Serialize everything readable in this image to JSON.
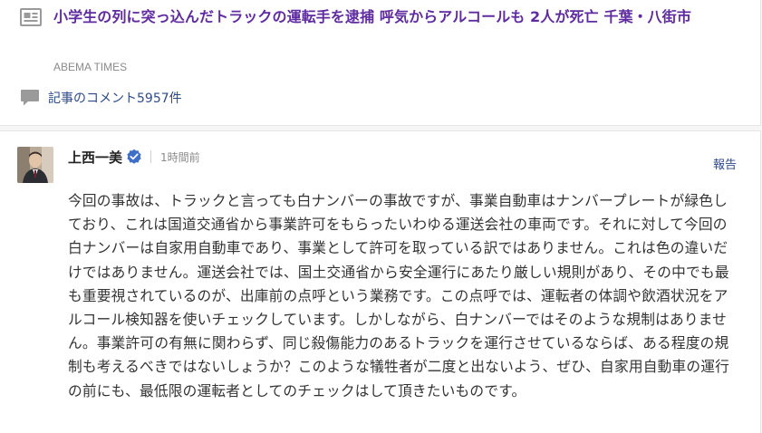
{
  "article": {
    "title": "小学生の列に突っ込んだトラックの運転手を逮捕 呼気からアルコールも 2人が死亡 千葉・八街市",
    "source": "ABEMA TIMES",
    "comments_link": "記事のコメント5957件",
    "icons": {
      "article": "news-article-icon",
      "comments": "speech-bubble-icon"
    }
  },
  "comment": {
    "author": "上西一美",
    "time": "1時間前",
    "report_label": "報告",
    "body": "今回の事故は、トラックと言っても白ナンバーの事故ですが、事業自動車はナンバープレートが緑色しており、これは国道交通省から事業許可をもらったいわゆる運送会社の車両です。それに対して今回の白ナンバーは自家用自動車であり、事業として許可を取っている訳ではありません。これは色の違いだけではありません。運送会社では、国土交通省から安全運行にあたり厳しい規則があり、その中でも最も重要視されているのが、出庫前の点呼という業務です。この点呼では、運転者の体調や飲酒状況をアルコール検知器を使いチェックしています。しかしながら、白ナンバーではそのような規制はありません。事業許可の有無に関わらず、同じ殺傷能力のあるトラックを運行させているならば、ある程度の規制も考えるべきではないしょうか？このような犠牲者が二度と出ないよう、ぜひ、自家用自動車の運行の前にも、最低限の運転者としてのチェックはして頂きたいものです。",
    "icons": {
      "avatar": "author-avatar",
      "verified": "verified-badge-icon"
    }
  },
  "colors": {
    "title": "#5f2ca0",
    "link": "#2e4a8a",
    "muted": "#8a8a8a",
    "verified": "#3d6fc9",
    "background": "#f6f6f6"
  }
}
